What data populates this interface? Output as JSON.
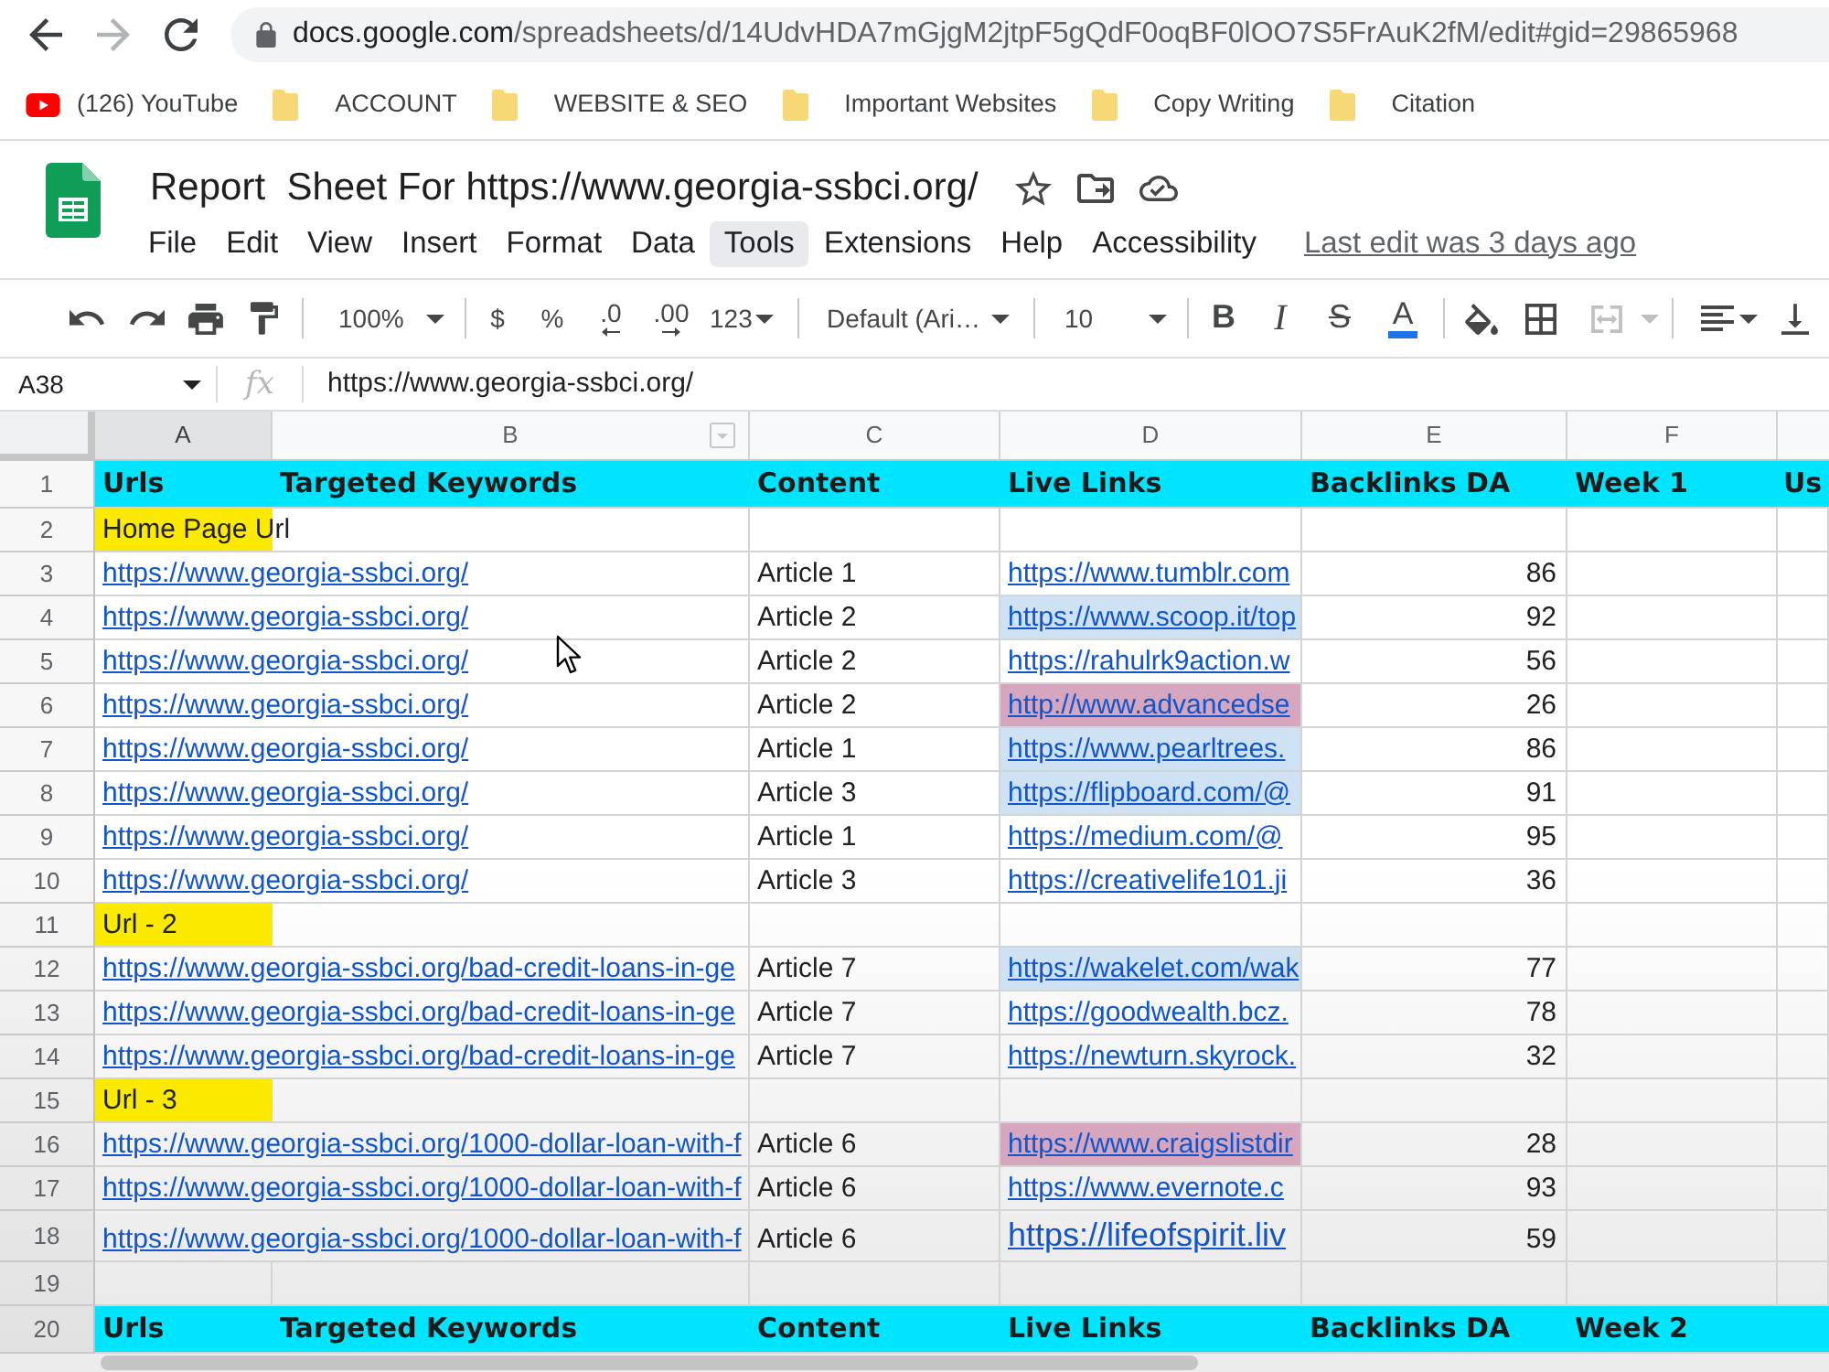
{
  "browser": {
    "nav": [
      {
        "kind": "back",
        "disabled": false
      },
      {
        "kind": "forward",
        "disabled": true
      },
      {
        "kind": "reload",
        "disabled": false
      }
    ],
    "url_host": "docs.google.com",
    "url_path": "/spreadsheets/d/14UdvHDA7mGjgM2jtpF5gQdF0oqBF0lOO7S5FrAuK2fM/edit#gid=29865968"
  },
  "bookmarks": [
    {
      "kind": "youtube",
      "label": "(126) YouTube"
    },
    {
      "kind": "folder",
      "label": "ACCOUNT"
    },
    {
      "kind": "folder",
      "label": "WEBSITE & SEO"
    },
    {
      "kind": "folder",
      "label": "Important Websites"
    },
    {
      "kind": "folder",
      "label": "Copy Writing"
    },
    {
      "kind": "folder",
      "label": "Citation"
    }
  ],
  "document": {
    "title": "Report  Sheet For https://www.georgia-ssbci.org/",
    "last_edit": "Last edit was 3 days ago"
  },
  "menu": [
    {
      "label": "File",
      "highlighted": false
    },
    {
      "label": "Edit",
      "highlighted": false
    },
    {
      "label": "View",
      "highlighted": false
    },
    {
      "label": "Insert",
      "highlighted": false
    },
    {
      "label": "Format",
      "highlighted": false
    },
    {
      "label": "Data",
      "highlighted": false
    },
    {
      "label": "Tools",
      "highlighted": true
    },
    {
      "label": "Extensions",
      "highlighted": false
    },
    {
      "label": "Help",
      "highlighted": false
    },
    {
      "label": "Accessibility",
      "highlighted": false
    }
  ],
  "toolbar": {
    "zoom": "100%",
    "currency": "$",
    "percent": "%",
    "decrease_decimal": ".0",
    "increase_decimal": ".00",
    "more_formats": "123",
    "font": "Default (Ari…",
    "font_size": "10",
    "bold": "B",
    "italic": "I",
    "strikethrough": "S",
    "text_color": "A"
  },
  "formula_bar": {
    "cell_ref": "A38",
    "function_label": "fx",
    "value": "https://www.georgia-ssbci.org/"
  },
  "sheet": {
    "columns": [
      {
        "label": "A",
        "selected": true,
        "hovered": false
      },
      {
        "label": "B",
        "selected": false,
        "hovered": true
      },
      {
        "label": "C",
        "selected": false,
        "hovered": false
      },
      {
        "label": "D",
        "selected": false,
        "hovered": false
      },
      {
        "label": "E",
        "selected": false,
        "hovered": false
      },
      {
        "label": "F",
        "selected": false,
        "hovered": false
      }
    ],
    "rows": [
      {
        "number": "1",
        "kind": "header",
        "cells": [
          "Urls",
          "Targeted Keywords",
          "Content",
          "Live Links",
          "Backlinks DA",
          "Week 1",
          "Us"
        ]
      },
      {
        "number": "2",
        "kind": "section",
        "label": "Home Page Url"
      },
      {
        "number": "3",
        "kind": "data",
        "url": "https://www.georgia-ssbci.org/",
        "content": "Article 1",
        "live_link": "https://www.tumblr.com",
        "backlinks_da": "86",
        "large_text": false
      },
      {
        "number": "4",
        "kind": "data",
        "url": "https://www.georgia-ssbci.org/",
        "content": "Article 2",
        "live_link": "https://www.scoop.it/top",
        "backlinks_da": "92",
        "large_text": false,
        "color": "#cfe2f3"
      },
      {
        "number": "5",
        "kind": "data",
        "url": "https://www.georgia-ssbci.org/",
        "content": "Article 2",
        "live_link": "https://rahulrk9action.w",
        "backlinks_da": "56",
        "large_text": false
      },
      {
        "number": "6",
        "kind": "data",
        "url": "https://www.georgia-ssbci.org/",
        "content": "Article 2",
        "live_link": "http://www.advancedse",
        "backlinks_da": "26",
        "large_text": false,
        "color": "#d5a6bd"
      },
      {
        "number": "7",
        "kind": "data",
        "url": "https://www.georgia-ssbci.org/",
        "content": "Article 1",
        "live_link": "https://www.pearltrees.",
        "backlinks_da": "86",
        "large_text": false,
        "color": "#cfe2f3"
      },
      {
        "number": "8",
        "kind": "data",
        "url": "https://www.georgia-ssbci.org/",
        "content": "Article 3",
        "live_link": "https://flipboard.com/@",
        "backlinks_da": "91",
        "large_text": false,
        "color": "#cfe2f3"
      },
      {
        "number": "9",
        "kind": "data",
        "url": "https://www.georgia-ssbci.org/",
        "content": "Article 1",
        "live_link": "https://medium.com/@",
        "backlinks_da": "95",
        "large_text": false
      },
      {
        "number": "10",
        "kind": "data",
        "url": "https://www.georgia-ssbci.org/",
        "content": "Article 3",
        "live_link": "https://creativelife101.ji",
        "backlinks_da": "36",
        "large_text": false
      },
      {
        "number": "11",
        "kind": "section",
        "label": "Url - 2"
      },
      {
        "number": "12",
        "kind": "data",
        "url": "https://www.georgia-ssbci.org/bad-credit-loans-in-ge",
        "content": "Article 7",
        "live_link": "https://wakelet.com/wak",
        "backlinks_da": "77",
        "large_text": false,
        "color": "#cfe2f3"
      },
      {
        "number": "13",
        "kind": "data",
        "url": "https://www.georgia-ssbci.org/bad-credit-loans-in-ge",
        "content": "Article 7",
        "live_link": "https://goodwealth.bcz.",
        "backlinks_da": "78",
        "large_text": false
      },
      {
        "number": "14",
        "kind": "data",
        "url": "https://www.georgia-ssbci.org/bad-credit-loans-in-ge",
        "content": "Article 7",
        "live_link": "https://newturn.skyrock.",
        "backlinks_da": "32",
        "large_text": false
      },
      {
        "number": "15",
        "kind": "section",
        "label": "Url - 3"
      },
      {
        "number": "16",
        "kind": "data",
        "url": "https://www.georgia-ssbci.org/1000-dollar-loan-with-f",
        "content": "Article 6",
        "live_link": "https://www.craigslistdir",
        "backlinks_da": "28",
        "large_text": false,
        "color": "#d5a6bd"
      },
      {
        "number": "17",
        "kind": "data",
        "url": "https://www.georgia-ssbci.org/1000-dollar-loan-with-f",
        "content": "Article 6",
        "live_link": "https://www.evernote.c",
        "backlinks_da": "93",
        "large_text": false
      },
      {
        "number": "18",
        "kind": "data",
        "url": "https://www.georgia-ssbci.org/1000-dollar-loan-with-f",
        "content": "Article 6",
        "live_link": "https://lifeofspirit.liv",
        "backlinks_da": "59",
        "large_text": true
      },
      {
        "number": "19",
        "kind": "empty"
      },
      {
        "number": "20",
        "kind": "header",
        "cells": [
          "Urls",
          "Targeted Keywords",
          "Content",
          "Live Links",
          "Backlinks DA",
          "Week 2"
        ]
      }
    ]
  }
}
